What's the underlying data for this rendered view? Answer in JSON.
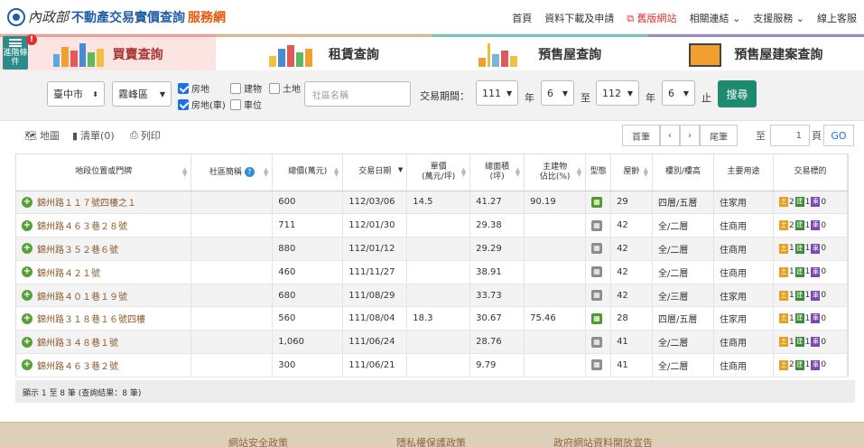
{
  "header": {
    "logo_min": "內政部",
    "title_main": "不動產交易實價查詢",
    "title_accent": "服務網",
    "nav": [
      "首頁",
      "資料下載及申請",
      "舊版網站",
      "相關連結",
      "支援服務",
      "線上客服"
    ]
  },
  "side_toggle": {
    "label": "進階條件",
    "badge": "!"
  },
  "tabs": [
    {
      "label": "買賣查詢",
      "active": true
    },
    {
      "label": "租賃查詢",
      "active": false
    },
    {
      "label": "預售屋查詢",
      "active": false
    },
    {
      "label": "預售屋建案查詢",
      "active": false
    }
  ],
  "filters": {
    "city": "臺中市",
    "district": "霧峰區",
    "types": [
      {
        "label": "房地",
        "checked": true
      },
      {
        "label": "建物",
        "checked": false
      },
      {
        "label": "土地",
        "checked": false
      },
      {
        "label": "房地(車)",
        "checked": true
      },
      {
        "label": "車位",
        "checked": false
      }
    ],
    "community_placeholder": "社區名稱",
    "period_label": "交易期間：",
    "start_year": "111",
    "year_label": "年",
    "start_month": "6",
    "to_label": "至",
    "end_year": "112",
    "end_month": "6",
    "end_label": "止",
    "search_button": "搜尋"
  },
  "toolbar": {
    "map": "地圖",
    "list": "清單(0)",
    "print": "列印",
    "first": "首筆",
    "prev": "‹",
    "next": "›",
    "last": "尾筆",
    "to": "至",
    "page_value": "1",
    "page_label": "頁",
    "go": "GO"
  },
  "table": {
    "headers": [
      "地段位置或門牌",
      "社區簡稱",
      "總價(萬元)",
      "交易日期",
      "單價\n(萬元/坪)",
      "總面積\n(坪)",
      "主建物\n佔比(%)",
      "型態",
      "屋齡",
      "樓別/樓高",
      "主要用途",
      "交易標的"
    ],
    "rows": [
      {
        "addr": "錦州路１１７號四樓之１",
        "comm": "",
        "price": "600",
        "date": "112/03/06",
        "unit": "14.5",
        "area": "41.27",
        "ratio": "90.19",
        "type": "green",
        "age": "29",
        "floor": "四層/五層",
        "use": "住家用",
        "l": "2",
        "b": "1",
        "p": "0"
      },
      {
        "addr": "錦州路４６３巷２８號",
        "comm": "",
        "price": "711",
        "date": "112/01/30",
        "unit": "",
        "area": "29.38",
        "ratio": "",
        "type": "gray",
        "age": "42",
        "floor": "全/二層",
        "use": "住商用",
        "l": "2",
        "b": "1",
        "p": "0"
      },
      {
        "addr": "錦州路３５２巷６號",
        "comm": "",
        "price": "880",
        "date": "112/01/12",
        "unit": "",
        "area": "29.29",
        "ratio": "",
        "type": "gray",
        "age": "42",
        "floor": "全/二層",
        "use": "住商用",
        "l": "1",
        "b": "1",
        "p": "0"
      },
      {
        "addr": "錦州路４２１號",
        "comm": "",
        "price": "460",
        "date": "111/11/27",
        "unit": "",
        "area": "38.91",
        "ratio": "",
        "type": "gray",
        "age": "42",
        "floor": "全/二層",
        "use": "住商用",
        "l": "1",
        "b": "1",
        "p": "0"
      },
      {
        "addr": "錦州路４０１巷１９號",
        "comm": "",
        "price": "680",
        "date": "111/08/29",
        "unit": "",
        "area": "33.73",
        "ratio": "",
        "type": "gray",
        "age": "42",
        "floor": "全/三層",
        "use": "住家用",
        "l": "1",
        "b": "1",
        "p": "0"
      },
      {
        "addr": "錦州路３１８巷１６號四樓",
        "comm": "",
        "price": "560",
        "date": "111/08/04",
        "unit": "18.3",
        "area": "30.67",
        "ratio": "75.46",
        "type": "green",
        "age": "28",
        "floor": "四層/五層",
        "use": "住家用",
        "l": "1",
        "b": "1",
        "p": "0"
      },
      {
        "addr": "錦州路３４８巷１號",
        "comm": "",
        "price": "1,060",
        "date": "111/06/24",
        "unit": "",
        "area": "28.76",
        "ratio": "",
        "type": "gray",
        "age": "41",
        "floor": "全/二層",
        "use": "住商用",
        "l": "1",
        "b": "1",
        "p": "0"
      },
      {
        "addr": "錦州路４６３巷２號",
        "comm": "",
        "price": "300",
        "date": "111/06/21",
        "unit": "",
        "area": "9.79",
        "ratio": "",
        "type": "gray",
        "age": "41",
        "floor": "全/二層",
        "use": "住商用",
        "l": "2",
        "b": "1",
        "p": "0"
      }
    ]
  },
  "tag_letters": {
    "land": "土",
    "building": "建",
    "parking": "車"
  },
  "summary": "顯示 1 至 8 筆 (查詢結果：8 筆)",
  "footer": [
    "網站安全政策",
    "隱私權保護政策",
    "政府網站資料開放宣告"
  ]
}
